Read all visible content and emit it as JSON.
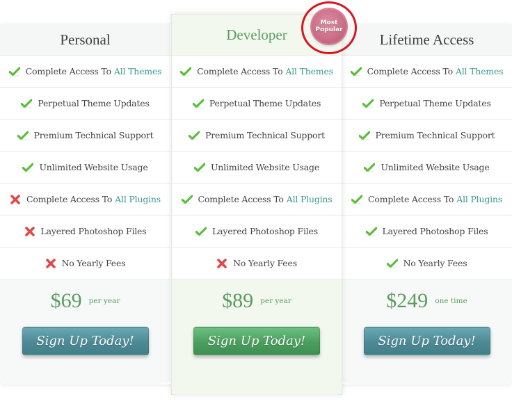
{
  "badge": {
    "line1": "Most",
    "line2": "Popular"
  },
  "plans": [
    {
      "name": "Personal",
      "price": "$69",
      "period": "per year",
      "cta": "Sign Up Today!",
      "features": [
        {
          "text": "Complete Access To",
          "highlight": "All Themes",
          "included": true
        },
        {
          "text": "Perpetual Theme Updates",
          "highlight": "",
          "included": true
        },
        {
          "text": "Premium Technical Support",
          "highlight": "",
          "included": true
        },
        {
          "text": "Unlimited Website Usage",
          "highlight": "",
          "included": true
        },
        {
          "text": "Complete Access To",
          "highlight": "All Plugins",
          "included": false
        },
        {
          "text": "Layered Photoshop Files",
          "highlight": "",
          "included": false
        },
        {
          "text": "No Yearly Fees",
          "highlight": "",
          "included": false
        }
      ]
    },
    {
      "name": "Developer",
      "price": "$89",
      "period": "per year",
      "cta": "Sign Up Today!",
      "features": [
        {
          "text": "Complete Access To",
          "highlight": "All Themes",
          "included": true
        },
        {
          "text": "Perpetual Theme Updates",
          "highlight": "",
          "included": true
        },
        {
          "text": "Premium Technical Support",
          "highlight": "",
          "included": true
        },
        {
          "text": "Unlimited Website Usage",
          "highlight": "",
          "included": true
        },
        {
          "text": "Complete Access To",
          "highlight": "All Plugins",
          "included": true
        },
        {
          "text": "Layered Photoshop Files",
          "highlight": "",
          "included": true
        },
        {
          "text": "No Yearly Fees",
          "highlight": "",
          "included": false
        }
      ]
    },
    {
      "name": "Lifetime Access",
      "price": "$249",
      "period": "one time",
      "cta": "Sign Up Today!",
      "features": [
        {
          "text": "Complete Access To",
          "highlight": "All Themes",
          "included": true
        },
        {
          "text": "Perpetual Theme Updates",
          "highlight": "",
          "included": true
        },
        {
          "text": "Premium Technical Support",
          "highlight": "",
          "included": true
        },
        {
          "text": "Unlimited Website Usage",
          "highlight": "",
          "included": true
        },
        {
          "text": "Complete Access To",
          "highlight": "All Plugins",
          "included": true
        },
        {
          "text": "Layered Photoshop Files",
          "highlight": "",
          "included": true
        },
        {
          "text": "No Yearly Fees",
          "highlight": "",
          "included": true
        }
      ]
    }
  ],
  "colors": {
    "check": "#5cbd3c",
    "cross": "#e04848",
    "link": "#3d9a8a",
    "price": "#5a9c5e",
    "teal_button": "#4c8a95",
    "green_button": "#4a9f5e",
    "badge_ring": "#d8141c"
  }
}
